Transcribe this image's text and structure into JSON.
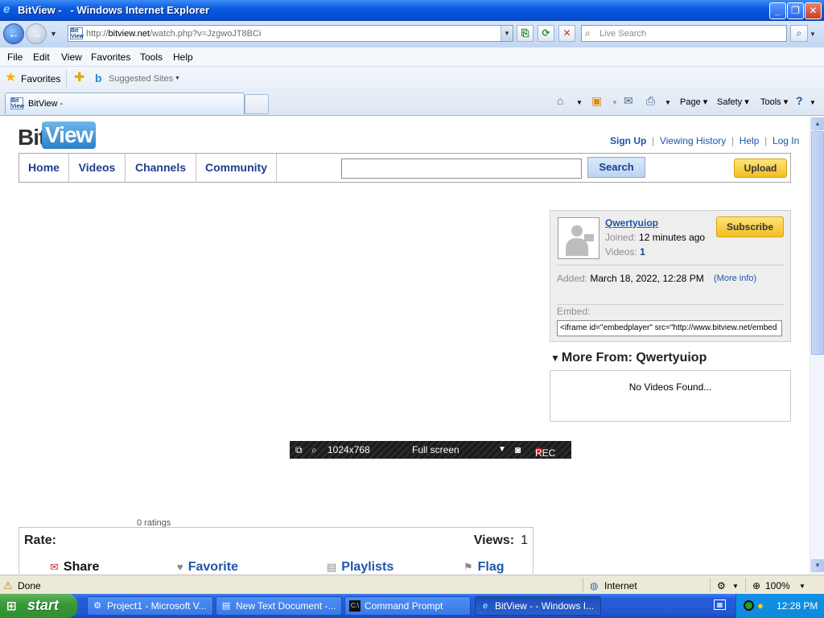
{
  "window": {
    "title": "BitView -   - Windows Internet Explorer"
  },
  "address": {
    "url_host": "bitview.net",
    "url_prefix": "http://",
    "url_path": "/watch.php?v=JzgwoJT8BCi",
    "search_placeholder": "Live Search"
  },
  "menu": [
    "File",
    "Edit",
    "View",
    "Favorites",
    "Tools",
    "Help"
  ],
  "favorites_bar": {
    "favorites_label": "Favorites",
    "suggested_sites": "Suggested Sites"
  },
  "tab": {
    "label": "BitView -"
  },
  "command_bar": {
    "page": "Page",
    "safety": "Safety",
    "tools": "Tools"
  },
  "site": {
    "logo_bit": "Bit",
    "logo_view": "View",
    "top_links": {
      "sign_up": "Sign Up",
      "viewing_history": "Viewing History",
      "help": "Help",
      "log_in": "Log In"
    },
    "nav": [
      "Home",
      "Videos",
      "Channels",
      "Community"
    ],
    "search_button": "Search",
    "upload_button": "Upload"
  },
  "channel": {
    "name": "Qwertyuiop",
    "joined_label": "Joined:",
    "joined_value": "12 minutes ago",
    "videos_label": "Videos:",
    "videos_value": "1",
    "subscribe": "Subscribe",
    "added_label": "Added:",
    "added_value": "March 18, 2022, 12:28 PM",
    "more_info": "(More info)",
    "embed_label": "Embed:",
    "embed_value": "<iframe id=\"embedplayer\" src=\"http://www.bitview.net/embed"
  },
  "more_from": {
    "title": "More From: Qwertyuiop",
    "empty": "No Videos Found..."
  },
  "recorder": {
    "resolution": "1024x768",
    "mode": "Full screen",
    "rec": "REC"
  },
  "rating": {
    "ratings_count": "0 ratings",
    "rate_label": "Rate:",
    "views_label": "Views:",
    "views_value": "1",
    "actions": [
      "Share",
      "Favorite",
      "Playlists",
      "Flag"
    ]
  },
  "status": {
    "text": "Done",
    "zone": "Internet",
    "zoom": "100%"
  },
  "taskbar": {
    "start": "start",
    "items": [
      "Project1 - Microsoft V...",
      "New Text Document -...",
      "Command Prompt",
      "BitView - - Windows I..."
    ],
    "clock": "12:28 PM"
  },
  "colors": {
    "link": "#1d56a8",
    "nav_text": "#1d3e8c",
    "button_yellow": "#f2bd1f",
    "titlebar_blue": "#0a5be0"
  }
}
